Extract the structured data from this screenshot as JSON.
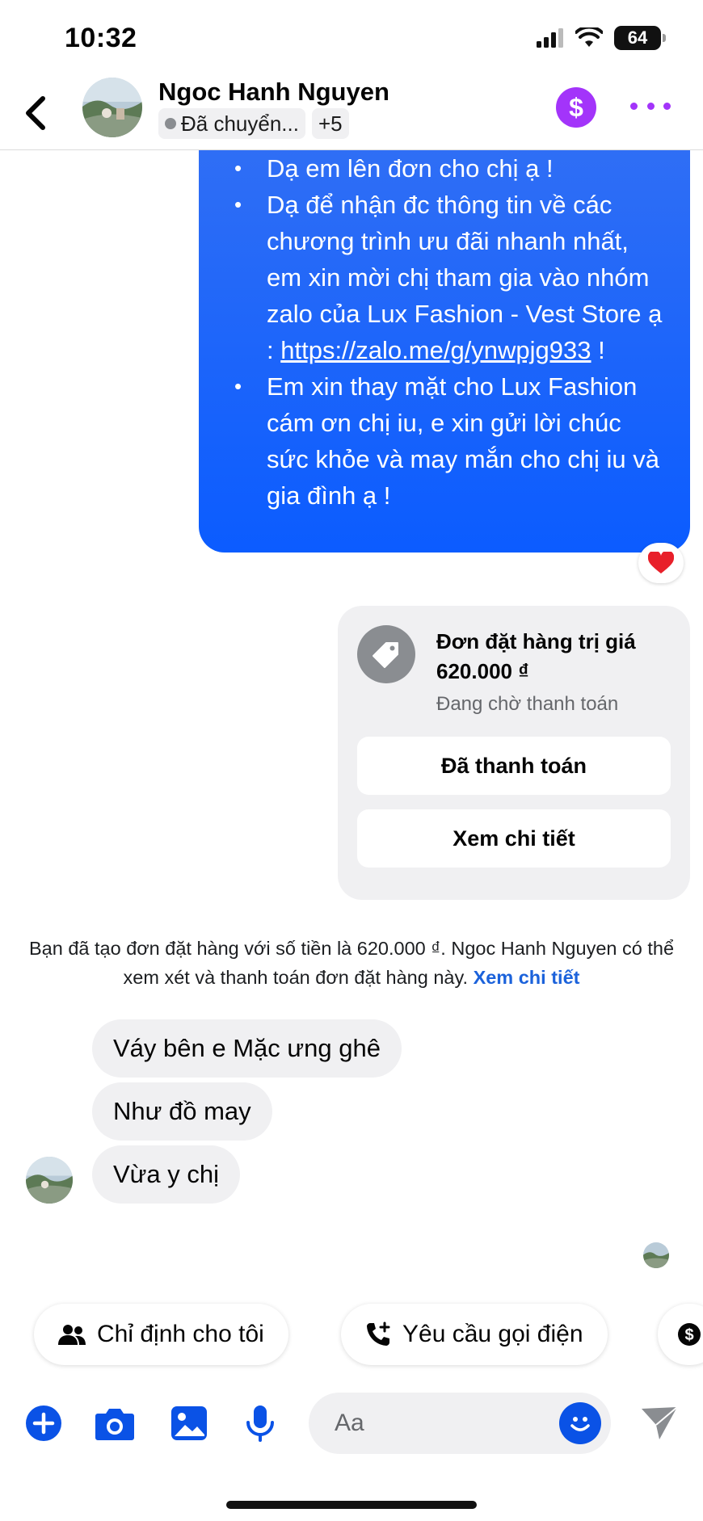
{
  "status_bar": {
    "time": "10:32",
    "battery": "64"
  },
  "header": {
    "name": "Ngoc Hanh Nguyen",
    "status_chip": "Đã chuyển...",
    "more_count": "+5",
    "accent_color": "#a334fa"
  },
  "outgoing": {
    "bullet_1": "Dạ em lên đơn cho chị ạ !",
    "bullet_2_text": "Dạ để nhận đc thông tin về các chương trình ưu đãi nhanh nhất, em xin mời chị tham gia vào nhóm zalo của Lux Fashion - Vest Store ạ : ",
    "bullet_2_link": "https://zalo.me/g/ynwpjg933",
    "bullet_2_tail": " !",
    "bullet_3": "Em xin thay mặt cho Lux Fashion cám ơn chị iu, e xin gửi lời chúc sức khỏe và may mắn cho chị iu và gia đình ạ !",
    "reaction": "heart-icon",
    "bubble_color": "#0b5cff"
  },
  "order_card": {
    "title": "Đơn đặt hàng trị giá 620.000 ₫",
    "status": "Đang chờ thanh toán",
    "paid_button": "Đã thanh toán",
    "details_button": "Xem chi tiết"
  },
  "system_note": {
    "text": "Bạn đã tạo đơn đặt hàng với số tiền là 620.000 ₫. Ngoc Hanh Nguyen có thể xem xét và thanh toán đơn đặt hàng này. ",
    "link": "Xem chi tiết"
  },
  "incoming": [
    {
      "text": "Váy bên e Mặc ưng ghê"
    },
    {
      "text": "Như đồ may"
    },
    {
      "text": "Vừa y chị"
    }
  ],
  "quick_replies": [
    {
      "label": "Chỉ định cho tôi",
      "icon": "people-icon"
    },
    {
      "label": "Yêu cầu gọi điện",
      "icon": "phone-add-icon"
    }
  ],
  "composer": {
    "placeholder": "Aa"
  }
}
